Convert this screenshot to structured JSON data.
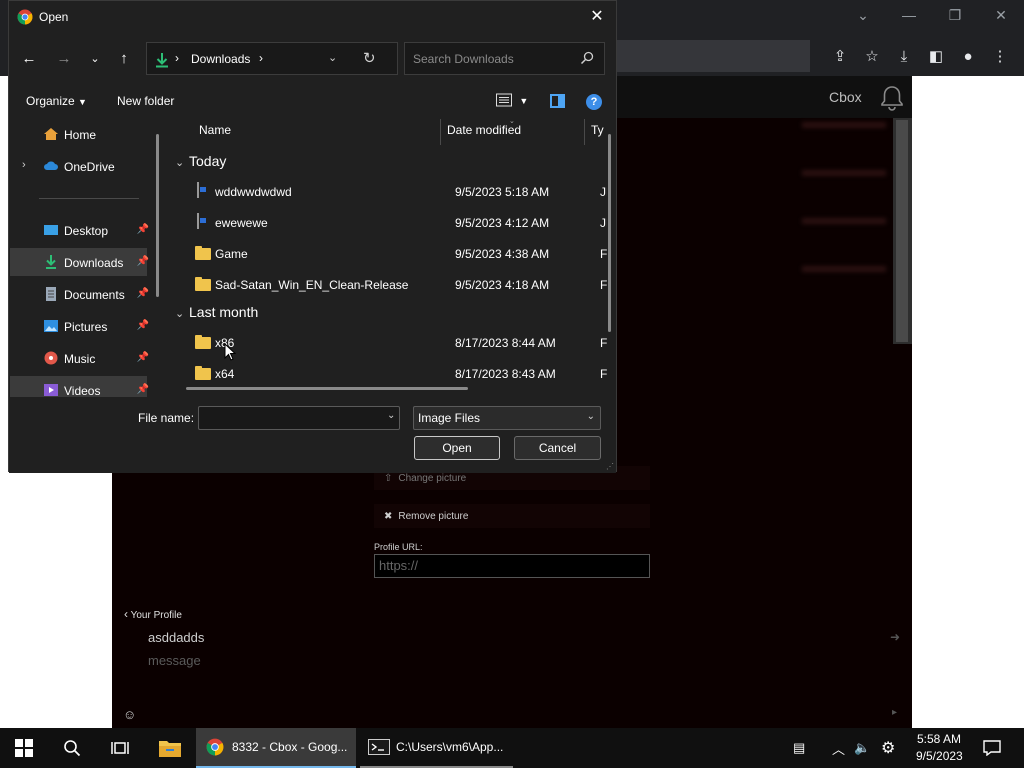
{
  "browser": {
    "cbox_title": "Cbox",
    "menu": {
      "change_picture": "Change picture",
      "remove_picture": "Remove picture"
    },
    "profile_url_label": "Profile URL:",
    "profile_url_placeholder": "https://",
    "your_profile": "Your Profile",
    "profile_name": "asddadds",
    "message_placeholder": "message"
  },
  "dialog": {
    "title": "Open",
    "address": {
      "folder": "Downloads"
    },
    "search_placeholder": "Search Downloads",
    "toolbar": {
      "organize": "Organize",
      "new_folder": "New folder"
    },
    "nav": [
      {
        "label": "Home"
      },
      {
        "label": "OneDrive"
      },
      {
        "label": "Desktop"
      },
      {
        "label": "Downloads"
      },
      {
        "label": "Documents"
      },
      {
        "label": "Pictures"
      },
      {
        "label": "Music"
      },
      {
        "label": "Videos"
      }
    ],
    "columns": {
      "name": "Name",
      "date": "Date modified",
      "type": "Ty"
    },
    "groups": [
      {
        "label": "Today",
        "files": [
          {
            "name": "wddwwdwdwd",
            "date": "9/5/2023 5:18 AM",
            "type": "JP",
            "kind": "image"
          },
          {
            "name": "ewewewe",
            "date": "9/5/2023 4:12 AM",
            "type": "JP",
            "kind": "image"
          },
          {
            "name": "Game",
            "date": "9/5/2023 4:38 AM",
            "type": "Fi",
            "kind": "folder"
          },
          {
            "name": "Sad-Satan_Win_EN_Clean-Release",
            "date": "9/5/2023 4:18 AM",
            "type": "Fi",
            "kind": "folder"
          }
        ]
      },
      {
        "label": "Last month",
        "files": [
          {
            "name": "x86",
            "date": "8/17/2023 8:44 AM",
            "type": "Fi",
            "kind": "folder"
          },
          {
            "name": "x64",
            "date": "8/17/2023 8:43 AM",
            "type": "Fi",
            "kind": "folder"
          }
        ]
      }
    ],
    "file_name_label": "File name:",
    "file_name_value": "",
    "filter": "Image Files",
    "open_button": "Open",
    "cancel_button": "Cancel"
  },
  "taskbar": {
    "chrome_item": "8332 - Cbox - Goog...",
    "cmd_item": "C:\\Users\\vm6\\App...",
    "time": "5:58 AM",
    "date": "9/5/2023"
  },
  "colors": {
    "folder": "#f0c44c",
    "accent": "#4ea5f4",
    "downloads_icon": "#2dbf76"
  }
}
